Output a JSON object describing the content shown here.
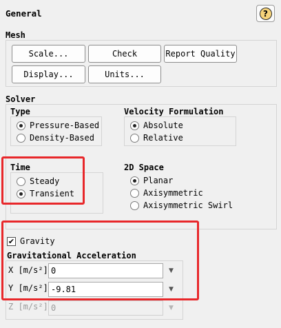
{
  "panel": {
    "title": "General",
    "help_icon": "question-mark-icon",
    "help_glyph": "?"
  },
  "mesh": {
    "label": "Mesh",
    "buttons": {
      "scale": "Scale...",
      "check": "Check",
      "report_quality": "Report Quality",
      "display": "Display...",
      "units": "Units..."
    }
  },
  "solver": {
    "label": "Solver",
    "type": {
      "label": "Type",
      "options": [
        "Pressure-Based",
        "Density-Based"
      ],
      "selected": "Pressure-Based"
    },
    "velocity": {
      "label": "Velocity Formulation",
      "options": [
        "Absolute",
        "Relative"
      ],
      "selected": "Absolute"
    },
    "time": {
      "label": "Time",
      "options": [
        "Steady",
        "Transient"
      ],
      "selected": "Transient"
    },
    "space2d": {
      "label": "2D Space",
      "options": [
        "Planar",
        "Axisymmetric",
        "Axisymmetric Swirl"
      ],
      "selected": "Planar"
    }
  },
  "gravity": {
    "checkbox_label": "Gravity",
    "checked": true,
    "check_glyph": "✔",
    "accel_label": "Gravitational Acceleration",
    "x": {
      "label": "X [m/s²]",
      "value": "0"
    },
    "y": {
      "label": "Y [m/s²]",
      "value": "-9.81"
    },
    "z": {
      "label": "Z [m/s²]",
      "value": "0"
    },
    "dropdown_glyph": "▼"
  },
  "colors": {
    "highlight": "#e8272a",
    "background": "#f0f0f0"
  }
}
